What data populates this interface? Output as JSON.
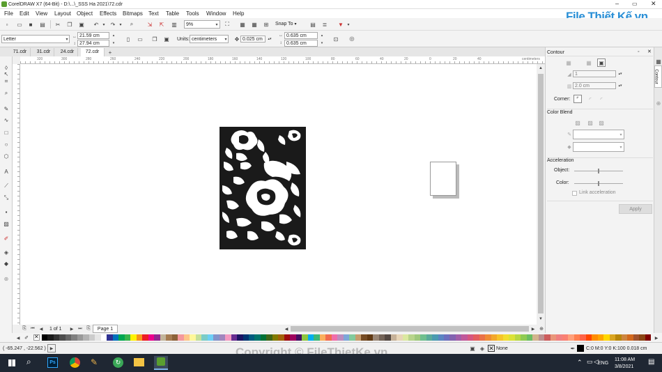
{
  "window": {
    "title": "CorelDRAW X7 (64-Bit) - D:\\...\\_SSS Ha 2021\\72.cdr"
  },
  "menu": [
    "File",
    "Edit",
    "View",
    "Layout",
    "Object",
    "Effects",
    "Bitmaps",
    "Text",
    "Table",
    "Tools",
    "Window",
    "Help"
  ],
  "watermark_logo": "File Thiết Kế.vn",
  "standard": {
    "zoom": "9%",
    "snap_to": "Snap To"
  },
  "property": {
    "page_size": "Letter",
    "width": "21.59 cm",
    "height": "27.94 cm",
    "units_label": "Units:",
    "units_value": "centimeters",
    "nudge": "0.025 cm",
    "dup_x": "0.635 cm",
    "dup_y": "0.635 cm"
  },
  "doc_tabs": [
    "71.cdr",
    "31.cdr",
    "24.cdr",
    "72.cdr"
  ],
  "ruler": {
    "h_ticks": [
      "320",
      "300",
      "280",
      "260",
      "240",
      "220",
      "200",
      "180",
      "160",
      "140",
      "120",
      "100",
      "80",
      "60",
      "40",
      "20",
      "0",
      "20",
      "40"
    ],
    "h_unit": "centimeters",
    "v_unit": "centimeters"
  },
  "page_nav": {
    "counter": "1 of 1",
    "page_tab": "Page 1"
  },
  "docker": {
    "title": "Contour",
    "steps_value": "1",
    "offset_value": "2.0 cm",
    "corner_label": "Corner:",
    "color_blend_label": "Color Blend",
    "acceleration_label": "Acceleration",
    "object_label": "Object:",
    "color_label": "Color:",
    "object_accel": 0.5,
    "color_accel": 0.5,
    "link_label": "Link acceleration",
    "apply_label": "Apply",
    "side_tab": "Contour"
  },
  "palette_colors": [
    "#000000",
    "#1a1a1a",
    "#333333",
    "#4d4d4d",
    "#666666",
    "#808080",
    "#999999",
    "#b3b3b3",
    "#cccccc",
    "#e6e6e6",
    "#ffffff",
    "#2e3192",
    "#0072bc",
    "#00a651",
    "#39b54a",
    "#fff200",
    "#f7941d",
    "#ed1c24",
    "#ec008c",
    "#92278f",
    "#c2b59b",
    "#a67c52",
    "#8c6239",
    "#f5989d",
    "#fdc689",
    "#fff799",
    "#c4df9b",
    "#7accc8",
    "#6dcff6",
    "#8393ca",
    "#a186be",
    "#f49ac1",
    "#662d91",
    "#1b1464",
    "#003471",
    "#005b7f",
    "#00746b",
    "#007236",
    "#406618",
    "#827b00",
    "#a36209",
    "#9e0b0f",
    "#9e005d",
    "#440e62",
    "#8dc63f",
    "#00aeef",
    "#3cb878",
    "#fbaf5d",
    "#f26c4f",
    "#f06eaa",
    "#bd8cbf",
    "#7da7d9",
    "#82ca9c",
    "#c69c6d",
    "#754c24",
    "#603913",
    "#998675",
    "#736357",
    "#534741",
    "#c7b299",
    "#e8d5b7",
    "#dbe8a0",
    "#b8d48b",
    "#9fc97d",
    "#6fbf8f",
    "#5aab9b",
    "#4b9bb1",
    "#5b85c2",
    "#6c6fbe",
    "#8263b0",
    "#a25ea8",
    "#c0589a",
    "#d6567f",
    "#e35d5f",
    "#ea7248",
    "#ef8c35",
    "#f3a82b",
    "#f6c42a",
    "#f2dd2f",
    "#dbe237",
    "#b7d744",
    "#8fcb52",
    "#6bbe62",
    "#d2b48c",
    "#bc8f8f",
    "#cd5c5c",
    "#e9967a",
    "#f08080",
    "#fa8072",
    "#ffa07a",
    "#ff7f50",
    "#ff6347",
    "#ff4500",
    "#ff8c00",
    "#ffa500",
    "#ffd700",
    "#daa520",
    "#b8860b",
    "#cd853f",
    "#d2691e",
    "#a0522d",
    "#8b4513",
    "#800000"
  ],
  "status": {
    "coords": "( -65.247 , -22.562 )",
    "fill_label": "None",
    "outline_label": "C:0 M:0 Y:0 K:100  0.018 cm"
  },
  "watermark": "Copyright © FileThietKe.vn",
  "taskbar": {
    "time": "11:08 AM",
    "date": "3/8/2021",
    "lang": "ENG"
  }
}
